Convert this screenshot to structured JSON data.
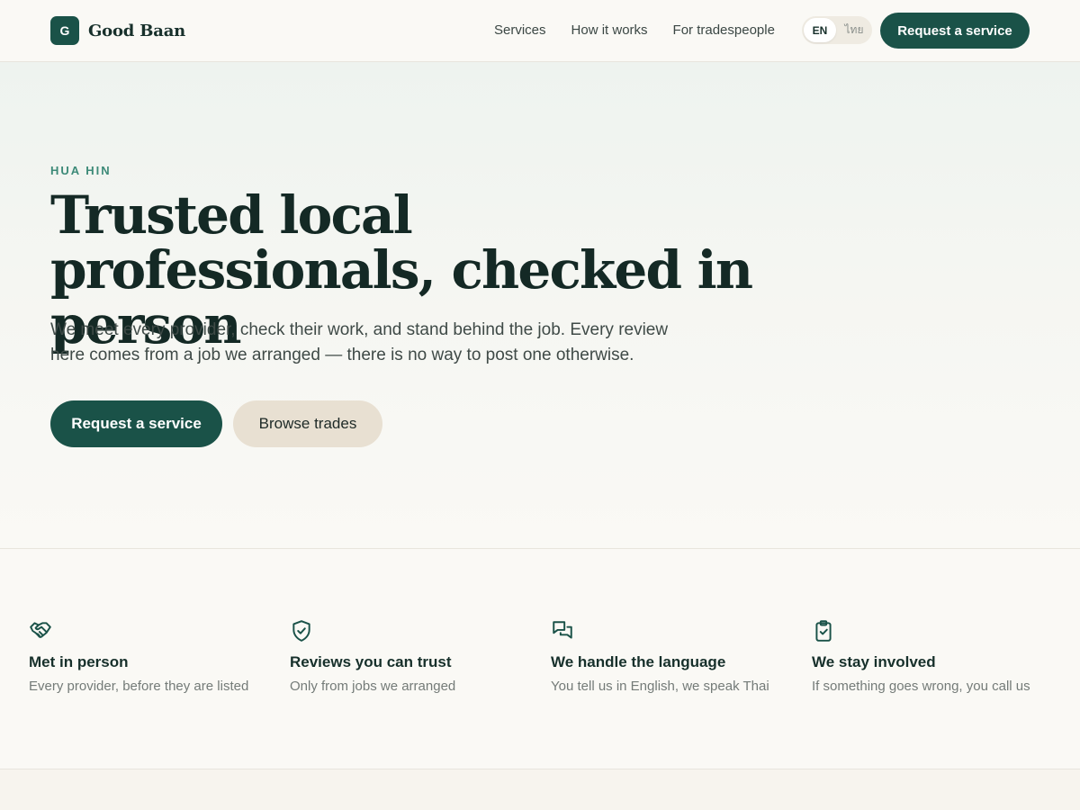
{
  "header": {
    "brand_mark": "G",
    "brand_name": "Good Baan",
    "nav": [
      "Services",
      "How it works",
      "For tradespeople"
    ],
    "lang_options": [
      "EN",
      "ไทย"
    ],
    "lang_selected": "EN",
    "cta_label": "Request a service"
  },
  "hero": {
    "eyebrow": "HUA HIN",
    "headline": "Trusted local professionals, checked in person",
    "lede": "We meet every provider, check their work, and stand behind the job. Every review here comes from a job we arranged — there is no way to post one otherwise.",
    "primary_label": "Request a service",
    "secondary_label": "Browse trades"
  },
  "features": [
    {
      "icon": "handshake-icon",
      "title": "Met in person",
      "subtitle": "Every provider, before they are listed"
    },
    {
      "icon": "shield-check-icon",
      "title": "Reviews you can trust",
      "subtitle": "Only from jobs we arranged"
    },
    {
      "icon": "chat-bubbles-icon",
      "title": "We handle the language",
      "subtitle": "You tell us in English, we speak Thai"
    },
    {
      "icon": "clipboard-check-icon",
      "title": "We stay involved",
      "subtitle": "If something goes wrong, you call us"
    }
  ],
  "colors": {
    "accent": "#1a5248",
    "eyebrow": "#3d8a78",
    "secondary_button": "#e8e0d2",
    "background": "#faf9f5"
  }
}
